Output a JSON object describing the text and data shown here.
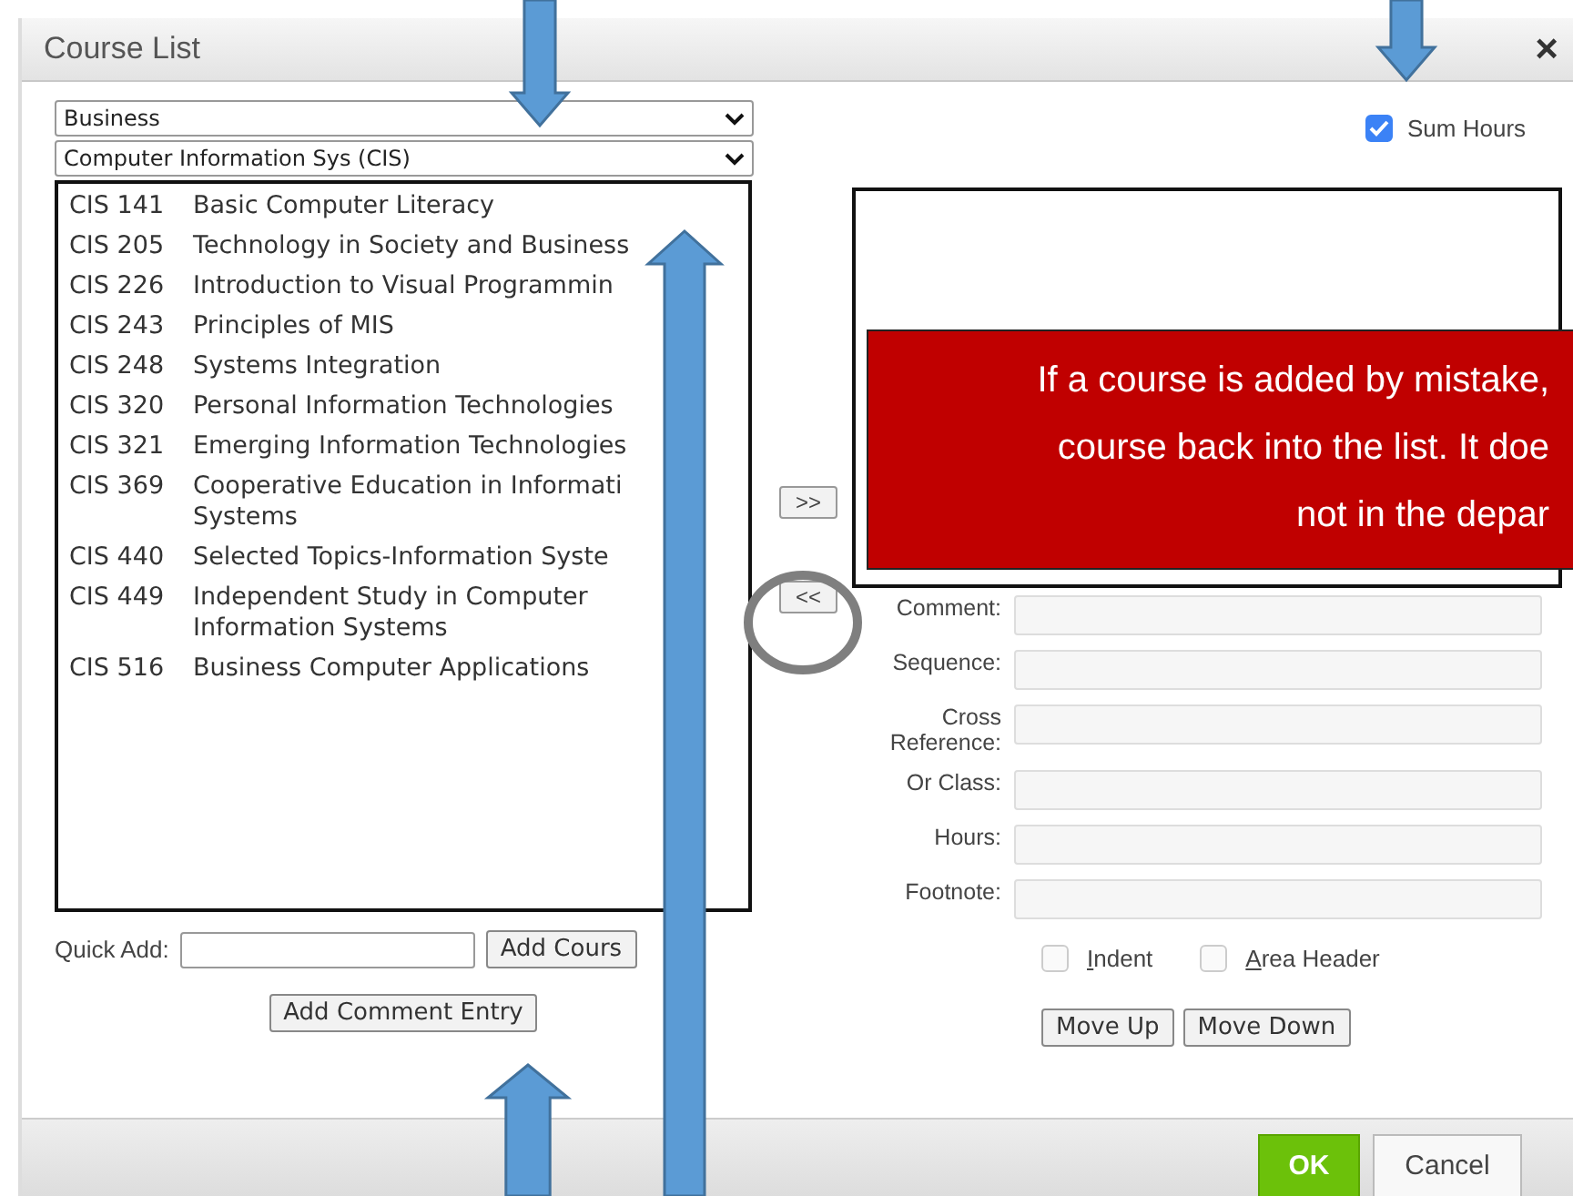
{
  "window": {
    "title": "Course List",
    "close": "×"
  },
  "filters": [
    {
      "value": "Business"
    },
    {
      "value": "Computer Information Sys (CIS)"
    }
  ],
  "courses": [
    {
      "code": "CIS 141",
      "title": "Basic Computer Literacy"
    },
    {
      "code": "CIS 205",
      "title": "Technology in Society and Business"
    },
    {
      "code": "CIS 226",
      "title": "Introduction to Visual Programmin"
    },
    {
      "code": "CIS 243",
      "title": "Principles of MIS"
    },
    {
      "code": "CIS 248",
      "title": "Systems Integration"
    },
    {
      "code": "CIS 320",
      "title": "Personal Information Technologies"
    },
    {
      "code": "CIS 321",
      "title": "Emerging Information Technologies"
    },
    {
      "code": "CIS 369",
      "title": "Cooperative Education in Informati Systems"
    },
    {
      "code": "CIS 440",
      "title": "Selected Topics-Information Syste"
    },
    {
      "code": "CIS 449",
      "title": "Independent Study in Computer Information Systems"
    },
    {
      "code": "CIS 516",
      "title": "Business Computer Applications"
    }
  ],
  "quick_add": {
    "label": "Quick Add:",
    "button": "Add Cours"
  },
  "add_comment_button": "Add Comment Entry",
  "move_buttons": {
    "add": ">>",
    "remove": "<<"
  },
  "sum_hours": {
    "label": "Sum Hours",
    "checked": true
  },
  "callout": {
    "lines": [
      "If a course is added by mistake,",
      "course back into the list. It doe",
      "not in the depar"
    ]
  },
  "fields": [
    {
      "label": "Comment:"
    },
    {
      "label": "Sequence:"
    },
    {
      "label": "Cross Reference:"
    },
    {
      "label": "Or Class:"
    },
    {
      "label": "Hours:"
    },
    {
      "label": "Footnote:"
    }
  ],
  "options": [
    {
      "label": "Indent",
      "checked": false
    },
    {
      "label": "Area Header",
      "checked": false
    }
  ],
  "order_buttons": [
    "Move Up",
    "Move Down"
  ],
  "footer": {
    "ok": "OK",
    "cancel": "Cancel"
  }
}
